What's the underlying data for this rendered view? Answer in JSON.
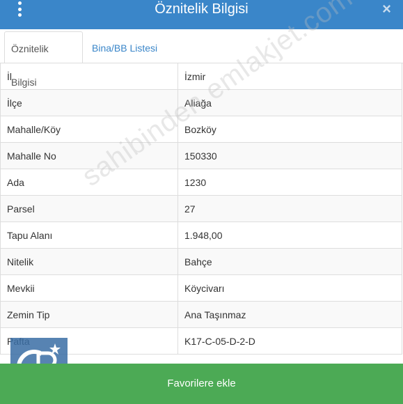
{
  "header": {
    "title": "Öznitelik Bilgisi",
    "menu_icon": "vertical-ellipsis-icon",
    "close_icon": "close-icon",
    "close_glyph": "×",
    "background_color": "#3a86c9"
  },
  "tabs": [
    {
      "label": "Öznitelik Bilgisi",
      "active": true
    },
    {
      "label": "Bina/BB Listesi",
      "active": false
    }
  ],
  "attributes": [
    {
      "key": "İl",
      "value": "İzmir"
    },
    {
      "key": "İlçe",
      "value": "Aliağa"
    },
    {
      "key": "Mahalle/Köy",
      "value": "Bozköy"
    },
    {
      "key": "Mahalle No",
      "value": "150330"
    },
    {
      "key": "Ada",
      "value": "1230"
    },
    {
      "key": "Parsel",
      "value": "27"
    },
    {
      "key": "Tapu Alanı",
      "value": "1.948,00"
    },
    {
      "key": "Nitelik",
      "value": "Bahçe"
    },
    {
      "key": "Mevkii",
      "value": "Köycivarı"
    },
    {
      "key": "Zemin Tip",
      "value": "Ana Taşınmaz"
    },
    {
      "key": "Pafta",
      "value": "K17-C-05-D-2-D"
    }
  ],
  "watermark": "sahibinden emlakjet.com",
  "logo": {
    "text": "CB"
  },
  "footer": {
    "favorite_button_label": "Favorilere ekle",
    "button_color": "#4caa55"
  }
}
